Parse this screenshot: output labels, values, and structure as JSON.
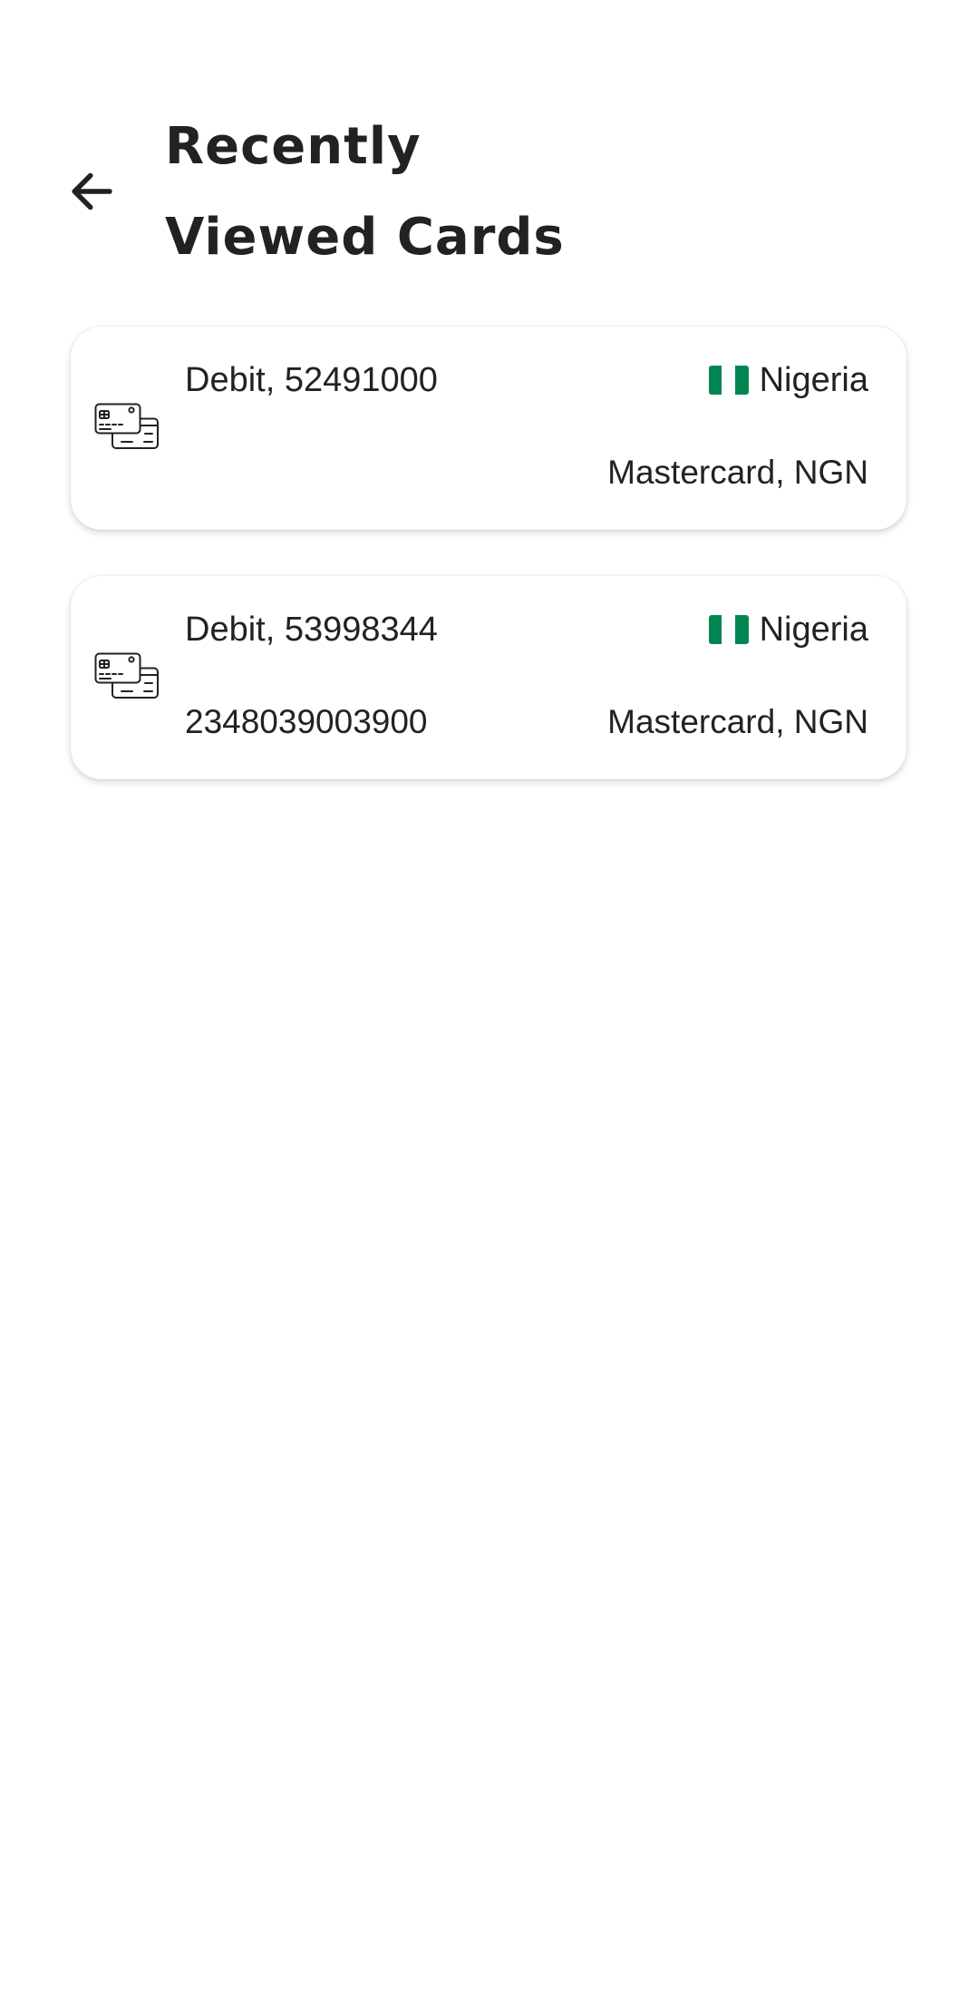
{
  "header": {
    "title_line1": "Recently",
    "title_line2": "Viewed Cards",
    "back_icon": "arrow-left-icon"
  },
  "colors": {
    "text": "#222222",
    "background": "#ffffff",
    "flag_green": "#008751",
    "flag_white": "#ffffff"
  },
  "cards": [
    {
      "title": "Debit, 52491000",
      "phone": "",
      "country": "Nigeria",
      "scheme": "Mastercard, NGN",
      "icon": "credit-cards-icon",
      "flag": "nigeria-flag-icon"
    },
    {
      "title": "Debit, 53998344",
      "phone": "2348039003900",
      "country": "Nigeria",
      "scheme": "Mastercard, NGN",
      "icon": "credit-cards-icon",
      "flag": "nigeria-flag-icon"
    }
  ]
}
